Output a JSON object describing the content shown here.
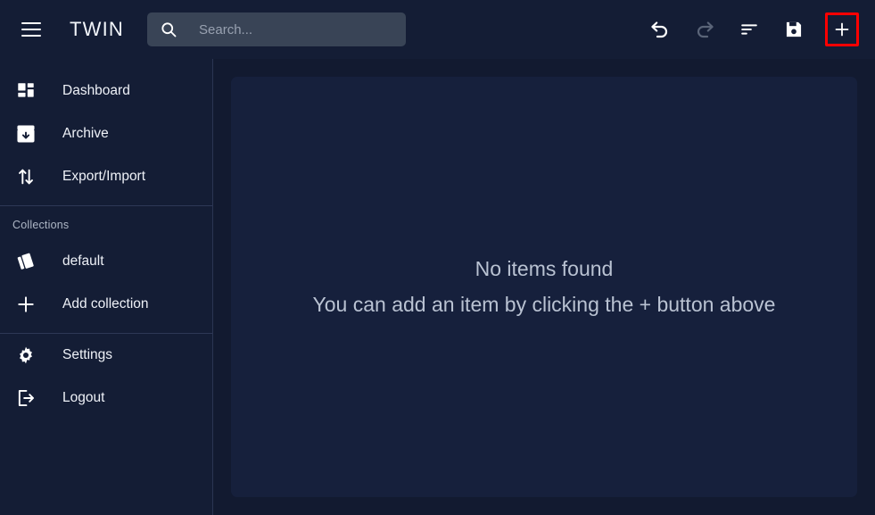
{
  "app": {
    "brand": "TWIN",
    "menu_icon": "hamburger-icon"
  },
  "search": {
    "placeholder": "Search...",
    "value": "",
    "icon": "search-icon"
  },
  "toolbar": {
    "buttons": [
      {
        "name": "undo-button",
        "icon": "undo-icon",
        "label": "Undo",
        "state": "enabled"
      },
      {
        "name": "redo-button",
        "icon": "redo-icon",
        "label": "Redo",
        "state": "disabled"
      },
      {
        "name": "sort-button",
        "icon": "sort-icon",
        "label": "Sort",
        "state": "enabled"
      },
      {
        "name": "save-button",
        "icon": "save-icon",
        "label": "Save",
        "state": "enabled"
      },
      {
        "name": "add-button",
        "icon": "plus-icon",
        "label": "Add item",
        "state": "highlighted"
      }
    ],
    "highlight_color": "#ff0000",
    "disabled_color": "#5a6478"
  },
  "sidebar": {
    "items": [
      {
        "label": "Dashboard",
        "icon": "dashboard-grid-icon"
      },
      {
        "label": "Archive",
        "icon": "archive-box-icon"
      },
      {
        "label": "Export/Import",
        "icon": "arrows-up-down-icon"
      }
    ],
    "collections_title": "Collections",
    "collections": [
      {
        "label": "default",
        "icon": "cards-stack-icon"
      },
      {
        "label": "Add collection",
        "icon": "plus-icon"
      }
    ],
    "footer_items": [
      {
        "label": "Settings",
        "icon": "gear-icon"
      },
      {
        "label": "Logout",
        "icon": "logout-arrow-icon"
      }
    ]
  },
  "main": {
    "empty_title": "No items found",
    "empty_subtitle": "You can add an item by clicking the + button above"
  },
  "colors": {
    "page_background": "#121a30",
    "chrome_background": "#141d35",
    "panel_background": "#16203c",
    "search_background": "#394456",
    "text_primary": "#eef1f7",
    "text_muted": "#b9c2d2",
    "border": "#2b3552"
  }
}
